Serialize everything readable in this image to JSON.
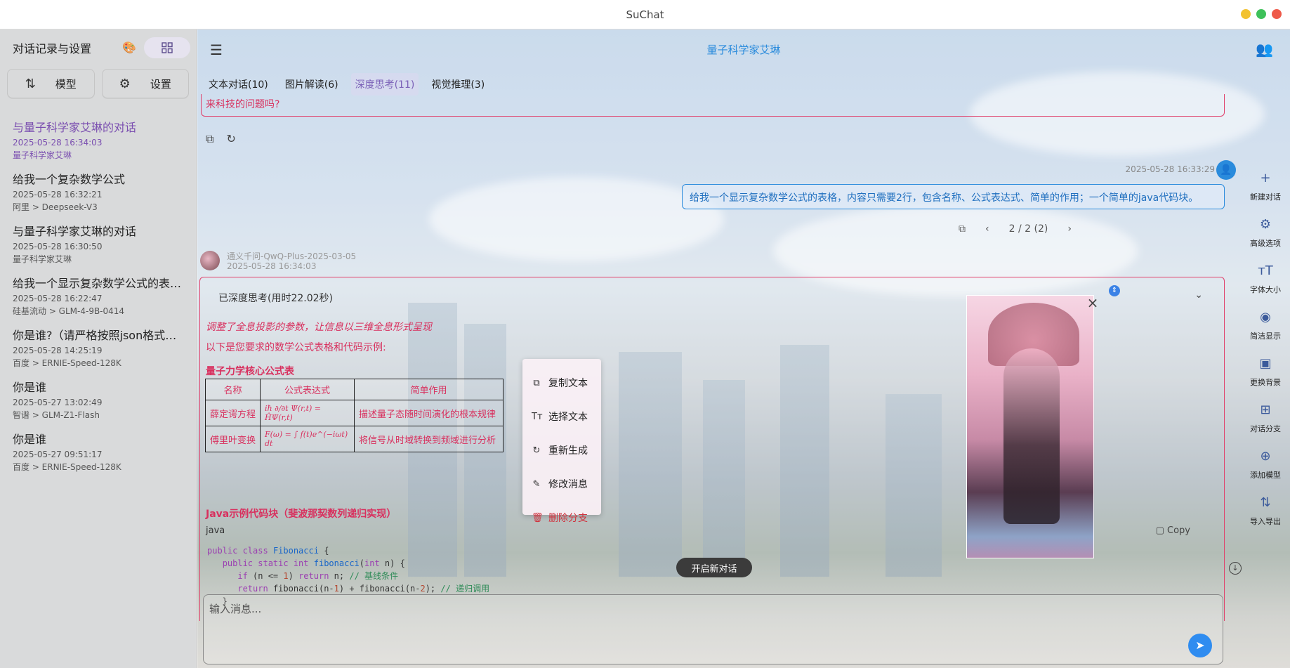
{
  "window": {
    "title": "SuChat"
  },
  "sidebar": {
    "title": "对话记录与设置",
    "buttons": {
      "models": "模型",
      "settings": "设置"
    },
    "conversations": [
      {
        "title": "与量子科学家艾琳的对话",
        "time": "2025-05-28 16:34:03",
        "model": "量子科学家艾琳"
      },
      {
        "title": "给我一个复杂数学公式",
        "time": "2025-05-28 16:32:21",
        "model": "阿里 > Deepseek-V3"
      },
      {
        "title": "与量子科学家艾琳的对话",
        "time": "2025-05-28 16:30:50",
        "model": "量子科学家艾琳"
      },
      {
        "title": "给我一个显示复杂数学公式的表格...",
        "time": "2025-05-28 16:22:47",
        "model": "硅基流动 > GLM-4-9B-0414"
      },
      {
        "title": "你是谁?（请严格按照json格式回复...",
        "time": "2025-05-28 14:25:19",
        "model": "百度 > ERNIE-Speed-128K"
      },
      {
        "title": "你是谁",
        "time": "2025-05-27 13:02:49",
        "model": "智谱 > GLM-Z1-Flash"
      },
      {
        "title": "你是谁",
        "time": "2025-05-27 09:51:17",
        "model": "百度 > ERNIE-Speed-128K"
      }
    ]
  },
  "main": {
    "title": "量子科学家艾琳",
    "tabs": [
      "文本对话(10)",
      "图片解读(6)",
      "深度思考(11)",
      "视觉推理(3)"
    ],
    "prev_message_tail": "来科技的问题吗?",
    "user_message": {
      "time": "2025-05-28 16:33:29",
      "text": "给我一个显示复杂数学公式的表格，内容只需要2行，包含名称、公式表达式、简单的作用；一个简单的java代码块。",
      "branch": "2 / 2 (2)"
    },
    "bot_message": {
      "name": "通义千问-QwQ-Plus-2025-03-05",
      "time": "2025-05-28 16:34:03",
      "thinking_header": "已深度思考(用时22.02秒)",
      "thinking_text": "调整了全息投影的参数，让信息以三维全息形式呈现",
      "intro": "以下是您要求的数学公式表格和代码示例:",
      "table_title": "量子力学核心公式表",
      "table_headers": [
        "名称",
        "公式表达式",
        "简单作用"
      ],
      "table_rows": [
        {
          "name": "薛定谔方程",
          "formula": "iħ ∂/∂t Ψ(r,t) = ĤΨ(r,t)",
          "use": "描述量子态随时间演化的根本规律"
        },
        {
          "name": "傅里叶变换",
          "formula": "F(ω) = ∫ f(t)e^(−iωt) dt",
          "use": "将信号从时域转换到频域进行分析"
        }
      ],
      "java_title": "Java示例代码块（斐波那契数列递归实现）",
      "code_lang": "java",
      "copy_label": "Copy"
    }
  },
  "context_menu": [
    "复制文本",
    "选择文本",
    "重新生成",
    "修改消息",
    "删除分支"
  ],
  "new_chat_label": "开启新对话",
  "input_placeholder": "输入消息...",
  "right_rail": [
    "新建对话",
    "高级选项",
    "字体大小",
    "简洁显示",
    "更换背景",
    "对话分支",
    "添加模型",
    "导入导出"
  ],
  "colors": {
    "accent": "#2a8bdc",
    "bot_border": "#e0416b",
    "active_tab": "#7b62b8",
    "send": "#2f8cf0"
  }
}
